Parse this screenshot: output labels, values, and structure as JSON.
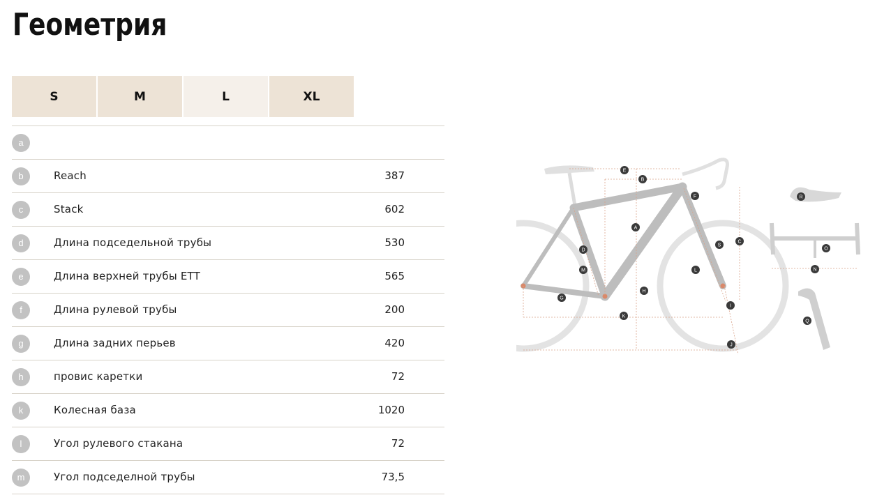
{
  "title": "Геометрия",
  "sizes": [
    "S",
    "M",
    "L",
    "XL"
  ],
  "active_size": "L",
  "rows": [
    {
      "badge": "a",
      "label": "",
      "value": ""
    },
    {
      "badge": "b",
      "label": "Reach",
      "value": "387"
    },
    {
      "badge": "c",
      "label": "Stack",
      "value": "602"
    },
    {
      "badge": "d",
      "label": "Длина подседельной трубы",
      "value": "530"
    },
    {
      "badge": "e",
      "label": "Длина верхней трубы ETT",
      "value": "565"
    },
    {
      "badge": "f",
      "label": "Длина рулевой трубы",
      "value": "200"
    },
    {
      "badge": "g",
      "label": "Длина задних перьев",
      "value": "420"
    },
    {
      "badge": "h",
      "label": "провис каретки",
      "value": "72"
    },
    {
      "badge": "k",
      "label": "Колесная база",
      "value": "1020"
    },
    {
      "badge": "l",
      "label": "Угол рулевого стакана",
      "value": "72"
    },
    {
      "badge": "m",
      "label": "Угол подседелной трубы",
      "value": "73,5"
    }
  ],
  "diagram_markers": [
    "E",
    "B",
    "A",
    "F",
    "C",
    "S",
    "D",
    "M",
    "L",
    "H",
    "G",
    "K",
    "I",
    "J",
    "R",
    "O",
    "N",
    "Q"
  ],
  "colors": {
    "tab": "#ede3d6",
    "tab_active": "#f5f0ea",
    "badge": "#c2c2c2",
    "frame": "#bdbdbd",
    "accent": "#d9896a"
  }
}
